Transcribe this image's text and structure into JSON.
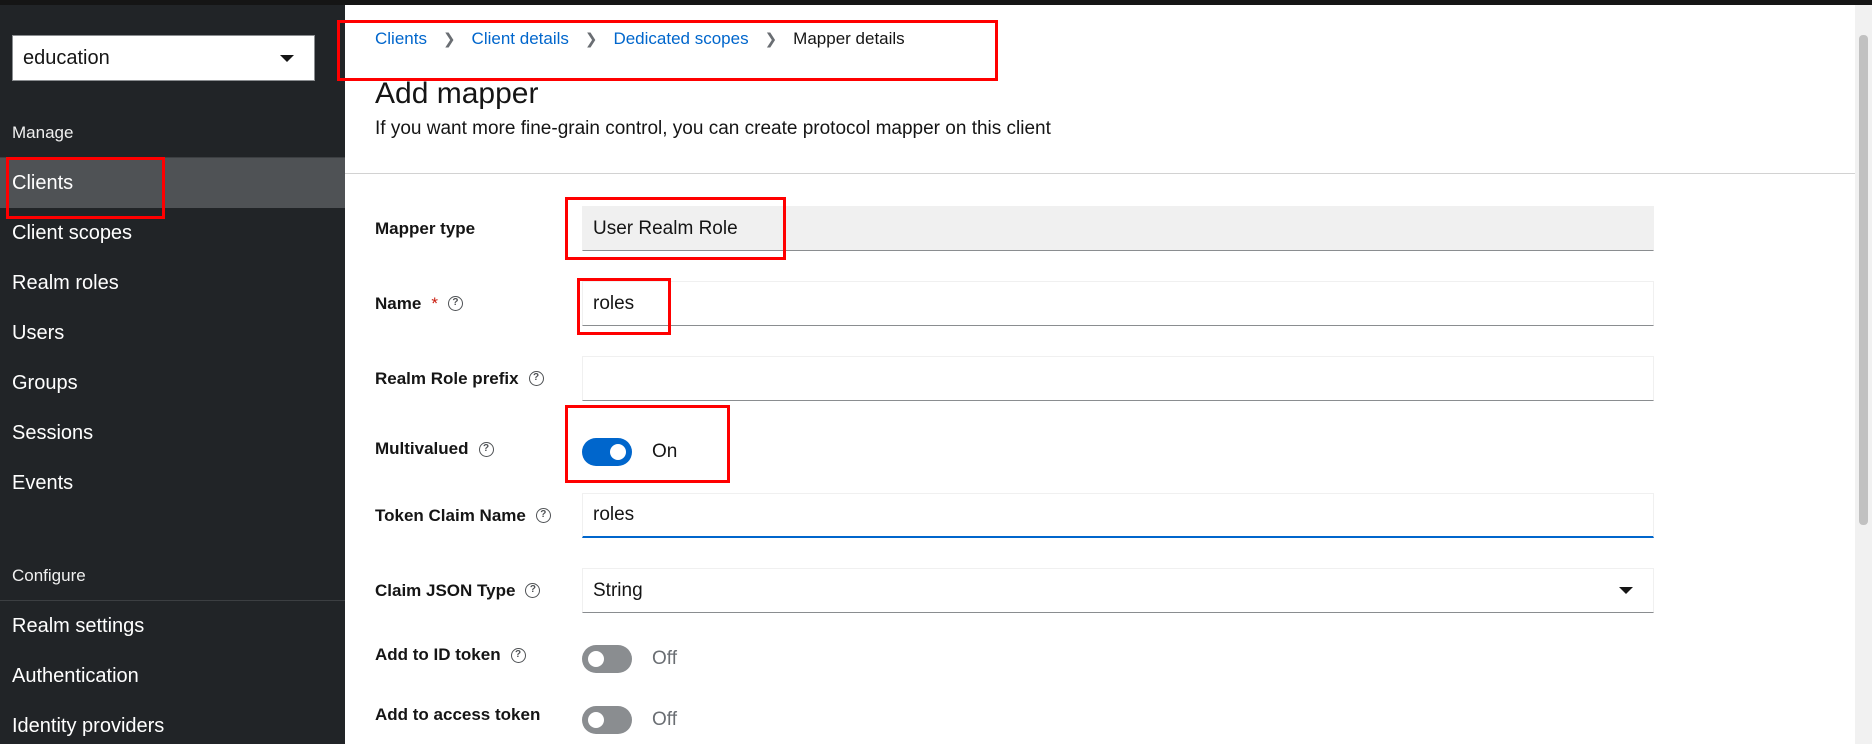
{
  "realm": {
    "selected": "education"
  },
  "sidebar": {
    "manage_heading": "Manage",
    "manage_items": [
      {
        "label": "Clients",
        "active": true
      },
      {
        "label": "Client scopes"
      },
      {
        "label": "Realm roles"
      },
      {
        "label": "Users"
      },
      {
        "label": "Groups"
      },
      {
        "label": "Sessions"
      },
      {
        "label": "Events"
      }
    ],
    "configure_heading": "Configure",
    "configure_items": [
      {
        "label": "Realm settings"
      },
      {
        "label": "Authentication"
      },
      {
        "label": "Identity providers"
      }
    ]
  },
  "breadcrumb": {
    "items": [
      "Clients",
      "Client details",
      "Dedicated scopes"
    ],
    "current": "Mapper details"
  },
  "page": {
    "title": "Add mapper",
    "subtitle": "If you want more fine-grain control, you can create protocol mapper on this client"
  },
  "form": {
    "mapper_type": {
      "label": "Mapper type",
      "value": "User Realm Role"
    },
    "name": {
      "label": "Name",
      "required": "*",
      "value": "roles"
    },
    "realm_role_prefix": {
      "label": "Realm Role prefix",
      "value": ""
    },
    "multivalued": {
      "label": "Multivalued",
      "state": "On"
    },
    "token_claim_name": {
      "label": "Token Claim Name",
      "value": "roles"
    },
    "claim_json_type": {
      "label": "Claim JSON Type",
      "value": "String"
    },
    "add_to_id_token": {
      "label": "Add to ID token",
      "state": "Off"
    },
    "add_to_access_token": {
      "label": "Add to access token",
      "state": "Off"
    }
  },
  "colors": {
    "accent": "#0066cc",
    "sidebar_bg": "#212427",
    "annotation": "#ff0000"
  }
}
